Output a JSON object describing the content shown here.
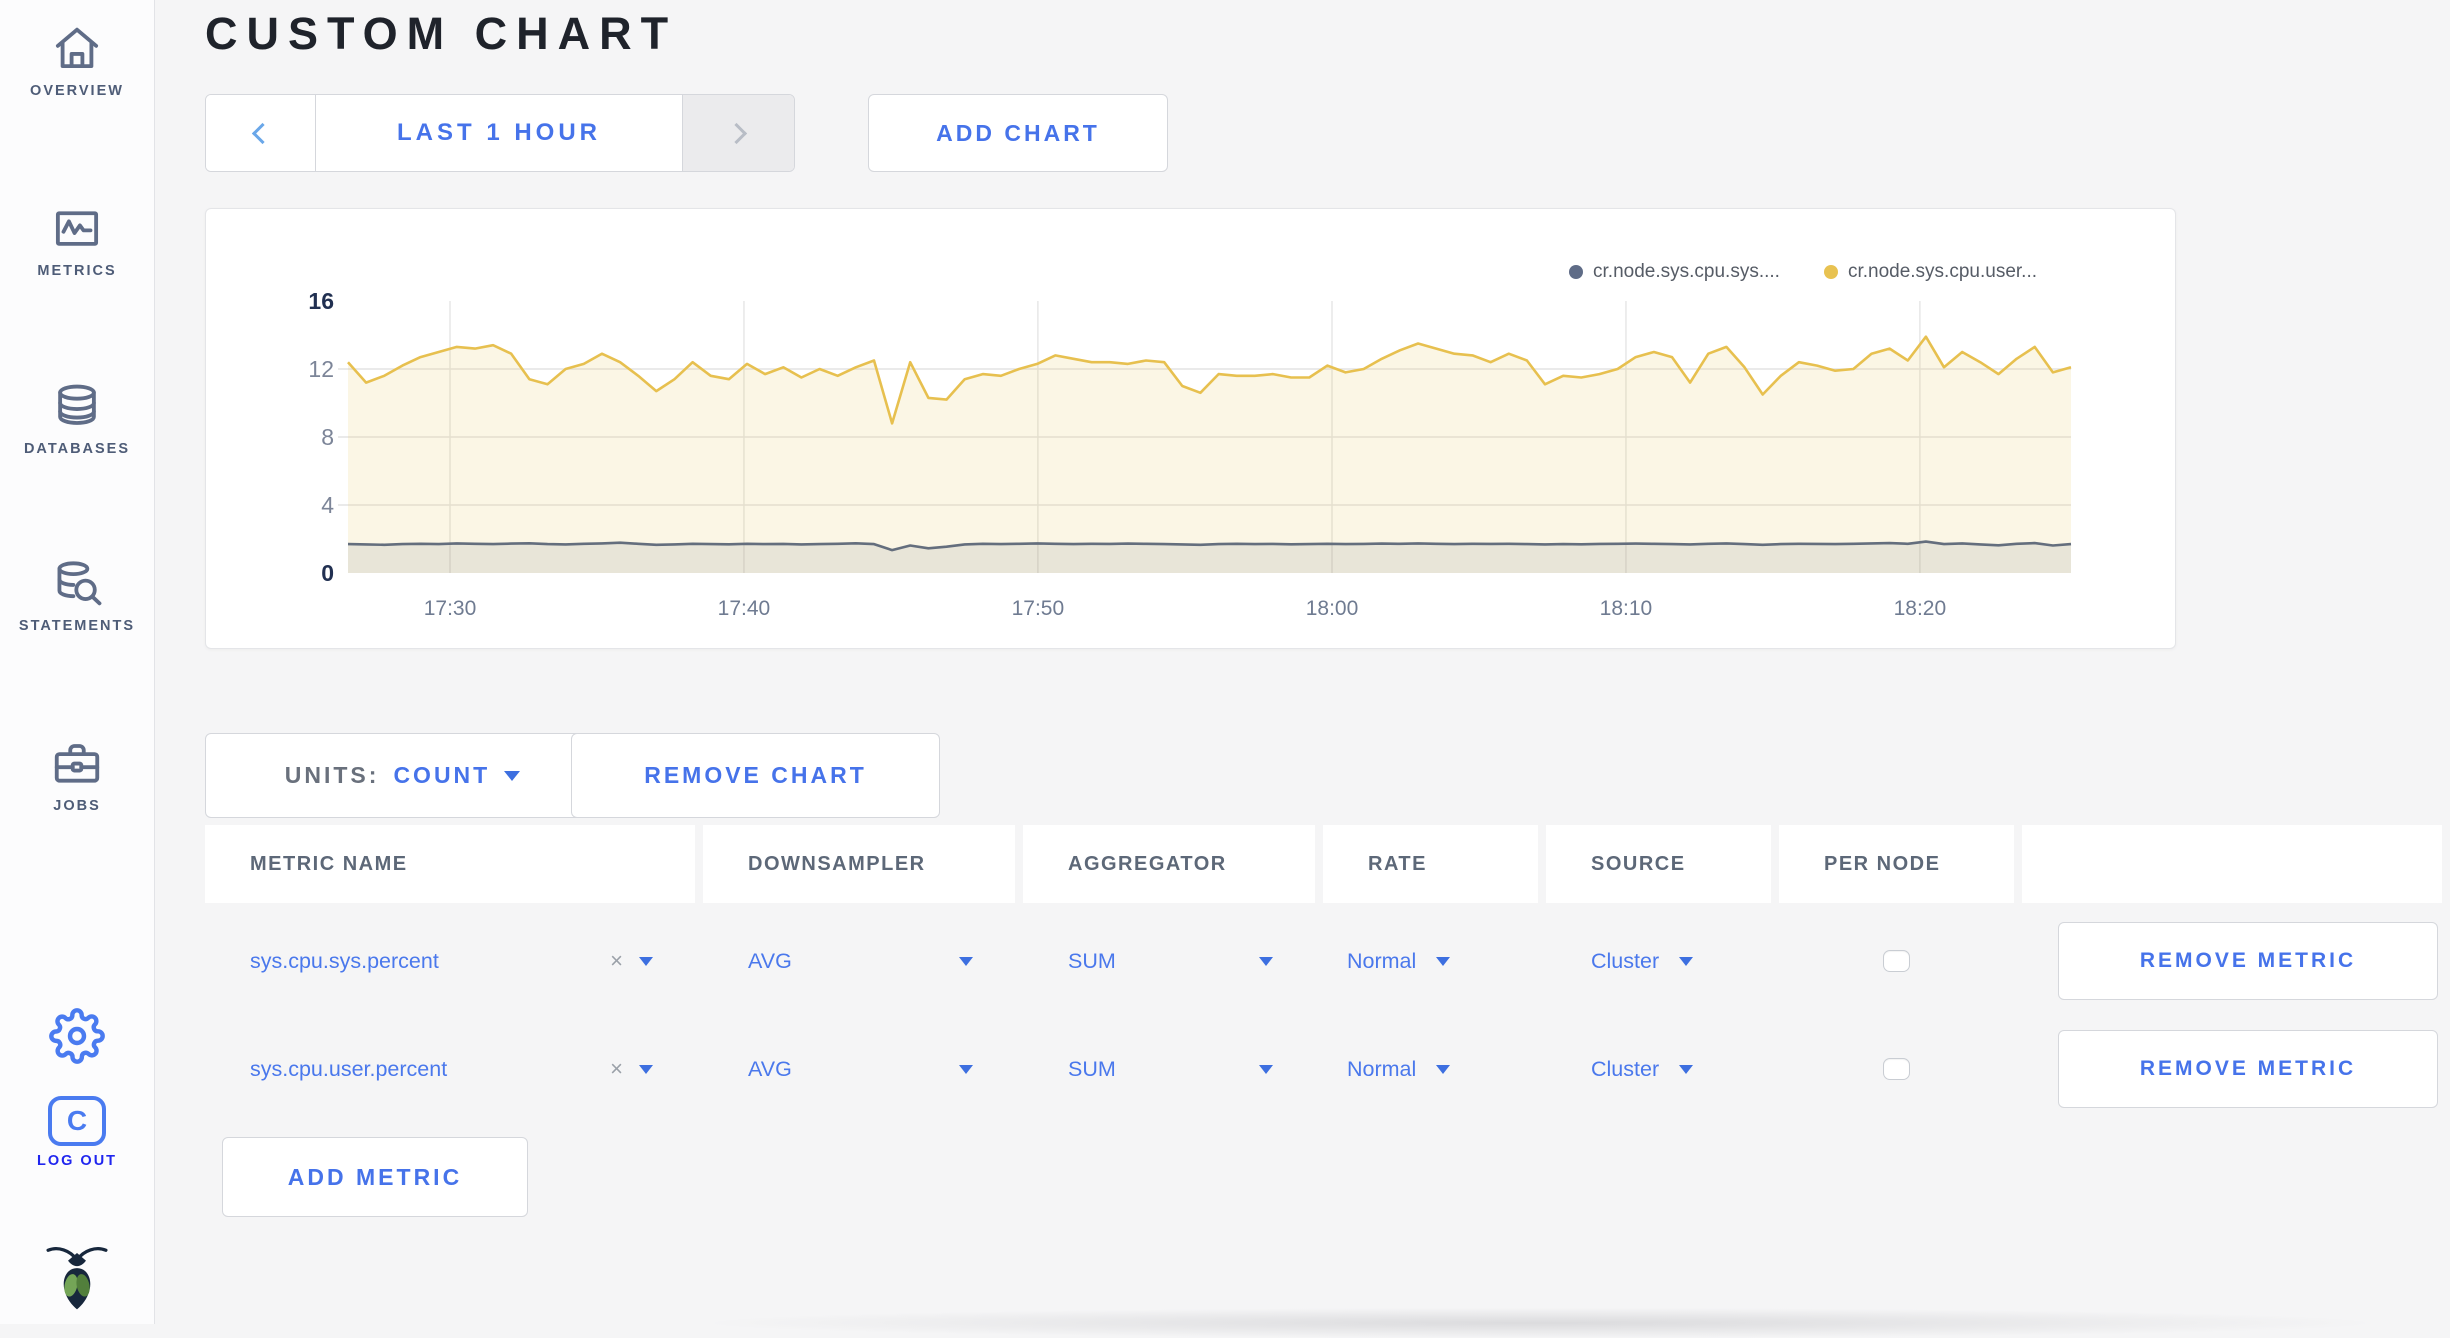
{
  "sidebar": {
    "items": [
      {
        "label": "OVERVIEW",
        "icon": "home-icon"
      },
      {
        "label": "METRICS",
        "icon": "metrics-icon"
      },
      {
        "label": "DATABASES",
        "icon": "database-icon"
      },
      {
        "label": "STATEMENTS",
        "icon": "statements-icon"
      },
      {
        "label": "JOBS",
        "icon": "briefcase-icon"
      }
    ],
    "logout_label": "LOG OUT"
  },
  "header": {
    "title": "CUSTOM CHART"
  },
  "time_selector": {
    "label": "LAST 1 HOUR"
  },
  "add_chart_label": "ADD CHART",
  "units": {
    "label": "UNITS:",
    "value": "COUNT"
  },
  "remove_chart_label": "REMOVE CHART",
  "add_metric_label": "ADD METRIC",
  "chart_data": {
    "type": "area",
    "title": "",
    "xlabel": "",
    "ylabel": "",
    "ylim": [
      0,
      16
    ],
    "yticks": [
      0,
      4,
      8,
      12,
      16
    ],
    "strong_yticks": [
      0,
      16
    ],
    "gridline_values": [
      4,
      8,
      12
    ],
    "x_ticks": [
      "17:30",
      "17:40",
      "17:50",
      "18:00",
      "18:10",
      "18:20"
    ],
    "x_tick_fracs": [
      0.0592,
      0.2298,
      0.4004,
      0.5711,
      0.7417,
      0.9123
    ],
    "legend_position": "top-right",
    "grid": true,
    "draw_order": [
      1,
      0
    ],
    "series": [
      {
        "name": "cr.node.sys.cpu.sys....",
        "color": "#646E7D",
        "dot_color": "#5F6C87",
        "fill": "rgba(106,115,130,0.13)",
        "values": [
          1.7,
          1.68,
          1.66,
          1.7,
          1.72,
          1.7,
          1.74,
          1.72,
          1.7,
          1.73,
          1.75,
          1.7,
          1.68,
          1.72,
          1.74,
          1.78,
          1.72,
          1.66,
          1.68,
          1.72,
          1.7,
          1.69,
          1.72,
          1.7,
          1.71,
          1.68,
          1.7,
          1.72,
          1.75,
          1.7,
          1.35,
          1.62,
          1.45,
          1.55,
          1.68,
          1.72,
          1.7,
          1.72,
          1.74,
          1.72,
          1.7,
          1.72,
          1.71,
          1.73,
          1.72,
          1.7,
          1.68,
          1.66,
          1.7,
          1.72,
          1.7,
          1.71,
          1.69,
          1.7,
          1.72,
          1.7,
          1.71,
          1.73,
          1.72,
          1.74,
          1.72,
          1.7,
          1.72,
          1.71,
          1.72,
          1.7,
          1.68,
          1.7,
          1.69,
          1.71,
          1.72,
          1.73,
          1.72,
          1.7,
          1.68,
          1.72,
          1.74,
          1.7,
          1.66,
          1.7,
          1.72,
          1.71,
          1.7,
          1.72,
          1.74,
          1.76,
          1.72,
          1.85,
          1.7,
          1.74,
          1.68,
          1.63,
          1.72,
          1.76,
          1.62,
          1.7
        ]
      },
      {
        "name": "cr.node.sys.cpu.user...",
        "color": "#E7C04F",
        "dot_color": "#E8C251",
        "fill": "rgba(231,193,83,0.15)",
        "values": [
          12.4,
          11.2,
          11.6,
          12.2,
          12.7,
          13.0,
          13.3,
          13.2,
          13.4,
          12.9,
          11.4,
          11.1,
          12.0,
          12.3,
          12.9,
          12.4,
          11.6,
          10.7,
          11.4,
          12.4,
          11.6,
          11.4,
          12.3,
          11.7,
          12.1,
          11.5,
          12.0,
          11.6,
          12.1,
          12.5,
          8.8,
          12.4,
          10.3,
          10.2,
          11.4,
          11.7,
          11.6,
          12.0,
          12.3,
          12.8,
          12.6,
          12.4,
          12.4,
          12.3,
          12.5,
          12.4,
          11.0,
          10.6,
          11.7,
          11.6,
          11.6,
          11.7,
          11.5,
          11.5,
          12.2,
          11.8,
          12.0,
          12.6,
          13.1,
          13.5,
          13.2,
          12.9,
          12.8,
          12.4,
          12.9,
          12.5,
          11.1,
          11.6,
          11.5,
          11.7,
          12.0,
          12.7,
          13.0,
          12.7,
          11.2,
          12.9,
          13.3,
          12.1,
          10.5,
          11.6,
          12.4,
          12.2,
          11.9,
          12.0,
          12.9,
          13.2,
          12.5,
          13.9,
          12.1,
          13.0,
          12.4,
          11.7,
          12.6,
          13.3,
          11.8,
          12.1
        ]
      }
    ]
  },
  "table": {
    "headers": [
      "METRIC NAME",
      "DOWNSAMPLER",
      "AGGREGATOR",
      "RATE",
      "SOURCE",
      "PER NODE",
      ""
    ],
    "clear_symbol": "×",
    "remove_label": "REMOVE METRIC",
    "rows": [
      {
        "metric": "sys.cpu.sys.percent",
        "downsampler": "AVG",
        "aggregator": "SUM",
        "rate": "Normal",
        "source": "Cluster",
        "per_node_checked": false
      },
      {
        "metric": "sys.cpu.user.percent",
        "downsampler": "AVG",
        "aggregator": "SUM",
        "rate": "Normal",
        "source": "Cluster",
        "per_node_checked": false
      }
    ]
  },
  "colors": {
    "accent_blue": "#4673ea",
    "logout_blue": "#2026ef",
    "sidebar_slate": "#5F6C87",
    "title_black": "#1f232b",
    "grid_gray": "#e5e5e5",
    "page_bg": "#f5f5f6"
  }
}
